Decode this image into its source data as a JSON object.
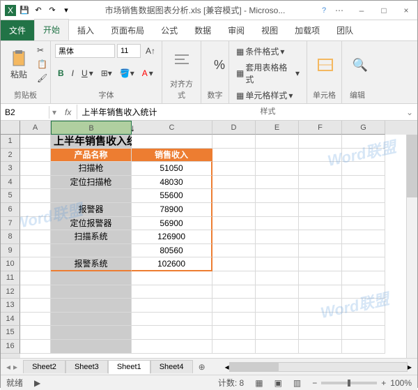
{
  "titlebar": {
    "filename": "市场销售数据图表分析.xls [兼容模式] - Microso..."
  },
  "menu": {
    "file": "文件",
    "items": [
      "开始",
      "插入",
      "页面布局",
      "公式",
      "数据",
      "审阅",
      "视图",
      "加载项",
      "团队"
    ],
    "active": 0
  },
  "ribbon": {
    "clipboard": {
      "paste": "粘贴",
      "label": "剪贴板"
    },
    "font": {
      "name": "黑体",
      "size": "11",
      "label": "字体"
    },
    "align": {
      "label": "对齐方式"
    },
    "number": {
      "label": "数字"
    },
    "styles": {
      "cond": "条件格式",
      "tablefmt": "套用表格格式",
      "cellstyle": "单元格样式",
      "label": "样式"
    },
    "cells": {
      "label": "单元格"
    },
    "editing": {
      "label": "编辑"
    }
  },
  "namebox": {
    "cell": "B2",
    "formula": "上半年销售收入统计"
  },
  "columns": [
    "A",
    "B",
    "C",
    "D",
    "E",
    "F",
    "G"
  ],
  "rows": [
    "1",
    "2",
    "3",
    "4",
    "5",
    "6",
    "7",
    "8",
    "9",
    "10",
    "11",
    "12",
    "13",
    "14",
    "15",
    "16"
  ],
  "data": {
    "title": "上半年销售收入统计",
    "headers": {
      "b": "产品名称",
      "c": "销售收入"
    },
    "items": [
      {
        "name": "扫描枪",
        "val": "51050"
      },
      {
        "name": "定位扫描枪",
        "val": "48030"
      },
      {
        "name": "",
        "val": "55600"
      },
      {
        "name": "报警器",
        "val": "78900"
      },
      {
        "name": "定位报警器",
        "val": "56900"
      },
      {
        "name": "扫描系统",
        "val": "126900"
      },
      {
        "name": "",
        "val": "80560"
      },
      {
        "name": "报警系统",
        "val": "102600"
      }
    ]
  },
  "chart_data": {
    "type": "table",
    "title": "上半年销售收入统计",
    "columns": [
      "产品名称",
      "销售收入"
    ],
    "rows": [
      [
        "扫描枪",
        51050
      ],
      [
        "定位扫描枪",
        48030
      ],
      [
        "",
        55600
      ],
      [
        "报警器",
        78900
      ],
      [
        "定位报警器",
        56900
      ],
      [
        "扫描系统",
        126900
      ],
      [
        "",
        80560
      ],
      [
        "报警系统",
        102600
      ]
    ]
  },
  "tabs": {
    "items": [
      "Sheet2",
      "Sheet3",
      "Sheet1",
      "Sheet4"
    ],
    "active": 2
  },
  "status": {
    "mode": "就绪",
    "count_label": "计数:",
    "count": "8",
    "zoom": "100%"
  },
  "watermark": "Word联盟"
}
